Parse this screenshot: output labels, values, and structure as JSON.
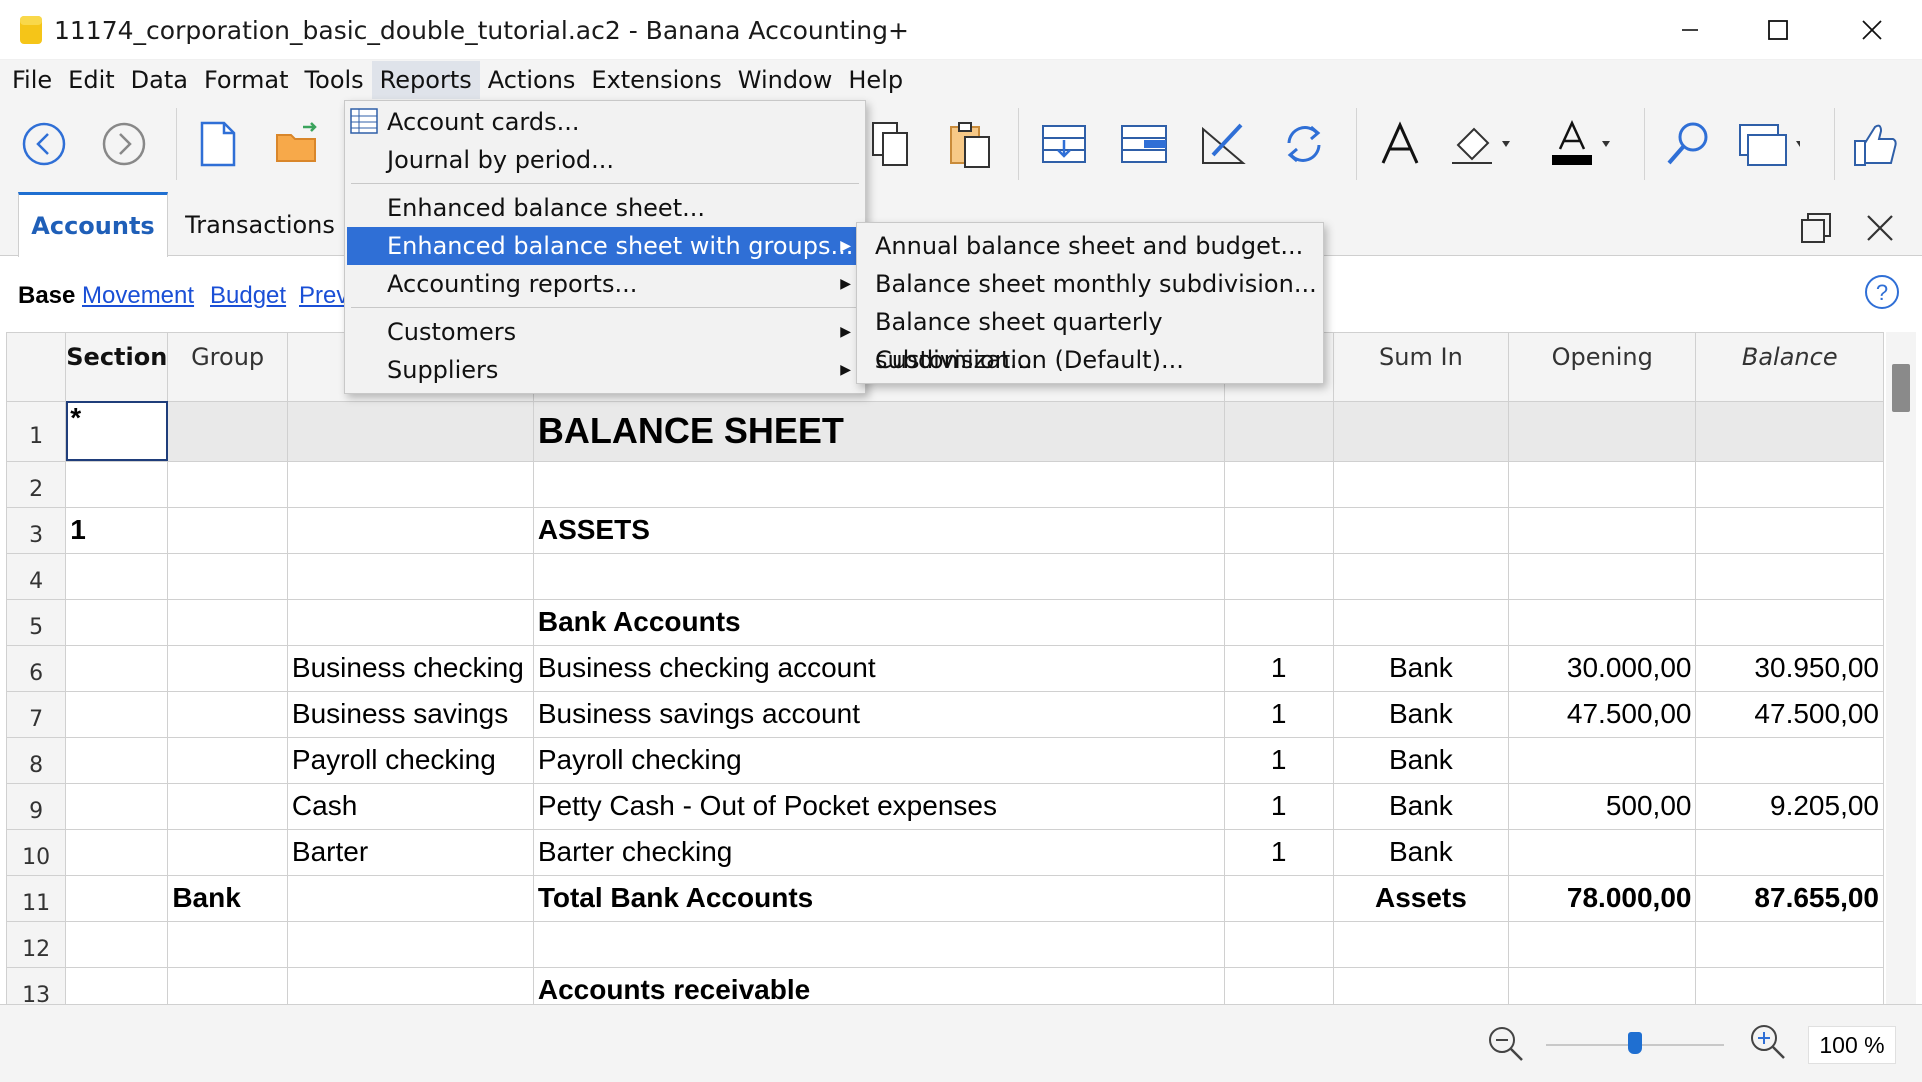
{
  "window": {
    "title": "11174_corporation_basic_double_tutorial.ac2 - Banana Accounting+"
  },
  "menubar": [
    "File",
    "Edit",
    "Data",
    "Format",
    "Tools",
    "Reports",
    "Actions",
    "Extensions",
    "Window",
    "Help"
  ],
  "active_menu": "Reports",
  "reports_menu": {
    "items": [
      {
        "label": "Account cards...",
        "has_icon": true
      },
      {
        "label": "Journal by period..."
      },
      {
        "label": "Enhanced balance sheet..."
      },
      {
        "label": "Enhanced balance sheet with groups...",
        "submenu": true,
        "highlighted": true
      },
      {
        "label": "Accounting reports...",
        "submenu": true
      },
      {
        "label": "Customers",
        "submenu": true
      },
      {
        "label": "Suppliers",
        "submenu": true
      }
    ]
  },
  "submenu": {
    "items": [
      "Annual balance sheet and budget...",
      "Balance sheet monthly subdivision...",
      "Balance sheet quarterly subdivision...",
      "Customization (Default)..."
    ]
  },
  "tabs": [
    "Accounts",
    "Transactions"
  ],
  "views": {
    "current": "Base",
    "links": [
      "Movement",
      "Budget",
      "Prev"
    ]
  },
  "table": {
    "headers": {
      "section": "Section",
      "group": "Group",
      "sumin": "Sum In",
      "opening": "Opening",
      "balance": "Balance"
    },
    "rows": [
      {
        "n": "1",
        "section": "*",
        "group": "",
        "account": "",
        "description": "BALANCE SHEET",
        "bclass": "",
        "sumin": "",
        "opening": "",
        "balance": ""
      },
      {
        "n": "2",
        "section": "",
        "group": "",
        "account": "",
        "description": "",
        "bclass": "",
        "sumin": "",
        "opening": "",
        "balance": ""
      },
      {
        "n": "3",
        "section": "1",
        "group": "",
        "account": "",
        "description": "ASSETS",
        "bclass": "",
        "sumin": "",
        "opening": "",
        "balance": ""
      },
      {
        "n": "4",
        "section": "",
        "group": "",
        "account": "",
        "description": "",
        "bclass": "",
        "sumin": "",
        "opening": "",
        "balance": ""
      },
      {
        "n": "5",
        "section": "",
        "group": "",
        "account": "",
        "description": "Bank Accounts",
        "bclass": "",
        "sumin": "",
        "opening": "",
        "balance": ""
      },
      {
        "n": "6",
        "section": "",
        "group": "",
        "account": "Business checking",
        "description": "Business checking account",
        "bclass": "1",
        "sumin": "Bank",
        "opening": "30.000,00",
        "balance": "30.950,00"
      },
      {
        "n": "7",
        "section": "",
        "group": "",
        "account": "Business savings",
        "description": "Business savings account",
        "bclass": "1",
        "sumin": "Bank",
        "opening": "47.500,00",
        "balance": "47.500,00"
      },
      {
        "n": "8",
        "section": "",
        "group": "",
        "account": "Payroll checking",
        "description": "Payroll checking",
        "bclass": "1",
        "sumin": "Bank",
        "opening": "",
        "balance": ""
      },
      {
        "n": "9",
        "section": "",
        "group": "",
        "account": "Cash",
        "description": "Petty Cash - Out of Pocket expenses",
        "bclass": "1",
        "sumin": "Bank",
        "opening": "500,00",
        "balance": "9.205,00"
      },
      {
        "n": "10",
        "section": "",
        "group": "",
        "account": "Barter",
        "description": "Barter checking",
        "bclass": "1",
        "sumin": "Bank",
        "opening": "",
        "balance": ""
      },
      {
        "n": "11",
        "section": "",
        "group": "Bank",
        "account": "",
        "description": "Total Bank Accounts",
        "bclass": "",
        "sumin": "Assets",
        "opening": "78.000,00",
        "balance": "87.655,00"
      },
      {
        "n": "12",
        "section": "",
        "group": "",
        "account": "",
        "description": "",
        "bclass": "",
        "sumin": "",
        "opening": "",
        "balance": ""
      },
      {
        "n": "13",
        "section": "",
        "group": "",
        "account": "",
        "description": "Accounts receivable",
        "bclass": "",
        "sumin": "",
        "opening": "",
        "balance": ""
      }
    ]
  },
  "status": {
    "zoom": "100 %",
    "zoom_level_percent": 100
  },
  "colors": {
    "accent": "#2f6fd6",
    "link": "#1a4fd6",
    "tab_active": "#1f5fb8"
  }
}
